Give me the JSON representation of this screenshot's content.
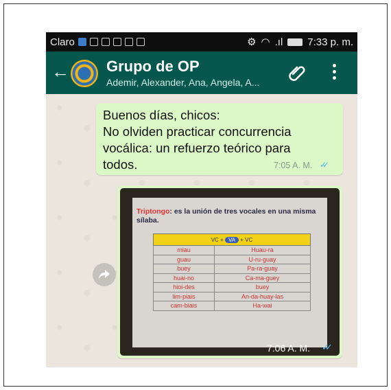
{
  "status_bar": {
    "carrier": "Claro",
    "time": "7:33 p. m."
  },
  "header": {
    "title": "Grupo de OP",
    "subtitle": "Ademir, Alexander, Ana, Angela, A..."
  },
  "messages": [
    {
      "text": "Buenos días, chicos:\nNo olviden practicar concurrencia vocálica: un refuerzo teórico para todos.",
      "time": "7:05 A. M.",
      "ticks": "✓✓"
    },
    {
      "type": "image",
      "time": "7:06 A. M.",
      "ticks": "✓✓"
    }
  ],
  "slide": {
    "term": "Triptongo",
    "definition": ": es la unión de tres vocales en una misma sílaba.",
    "formula_left": "VC +",
    "formula_mid": "VA",
    "formula_right": "+ VC",
    "rows": [
      [
        "miau",
        "Huau-ra"
      ],
      [
        "guau",
        "U-ru-guay"
      ],
      [
        "buey",
        "Pa-ra-guay"
      ],
      [
        "huai-no",
        "Ca-ma-guey"
      ],
      [
        "hioi-des",
        "buey"
      ],
      [
        "lim-piais",
        "An-da-huay-las"
      ],
      [
        "cam-biais",
        "Ha-wai"
      ]
    ]
  },
  "colors": {
    "header_bg": "#06584f",
    "bubble_out": "#dcf8c6",
    "read_ticks": "#4fb6ec"
  },
  "icons": [
    "back-arrow-icon",
    "attach-icon",
    "more-options-icon",
    "forward-icon"
  ]
}
